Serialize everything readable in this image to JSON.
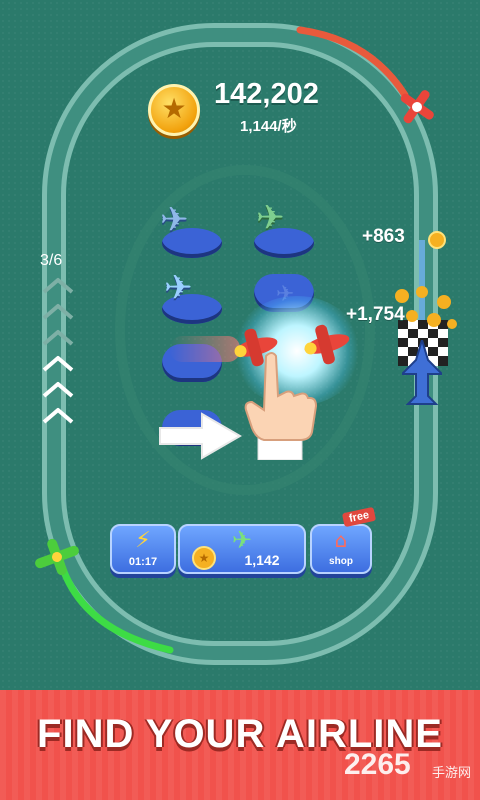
{
  "wallet": {
    "coins": "142,202",
    "rate": "1,144/秒",
    "coin_icon": "star-coin-icon"
  },
  "progress": {
    "level": "3/6",
    "current": 3,
    "total": 6
  },
  "floating_rewards": [
    {
      "text": "+863"
    },
    {
      "text": "+1,754"
    }
  ],
  "buttons": {
    "boost_timer": "01:17",
    "buy_plane_cost": "1,142",
    "shop_label": "shop",
    "shop_badge": "free"
  },
  "banner": {
    "title": "FIND YOUR AIRLINE",
    "watermark": "2265",
    "watermark_sub": "手游网"
  },
  "colors": {
    "board": "#2b7a6b",
    "track": "#5ea89a",
    "button": "#3d6ee0",
    "banner": "#f1524c",
    "coin": "#f2a10c"
  }
}
